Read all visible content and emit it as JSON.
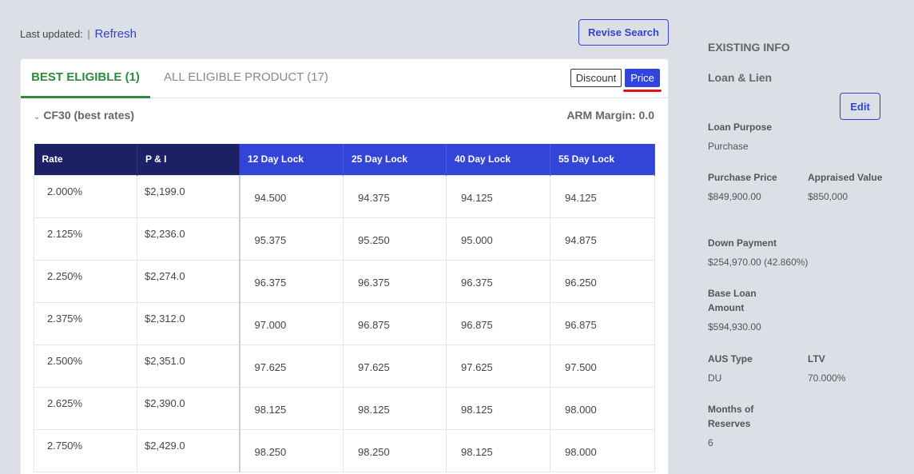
{
  "topbar": {
    "last_updated_label": "Last updated:",
    "separator": "|",
    "refresh_label": "Refresh"
  },
  "revise_search_label": "Revise Search",
  "tabs": [
    {
      "label": "BEST ELIGIBLE (1)"
    },
    {
      "label": "ALL ELIGIBLE PRODUCT (17)"
    }
  ],
  "toggle": {
    "discount_label": "Discount",
    "price_label": "Price"
  },
  "group": {
    "label": "CF30 (best rates)",
    "arm_margin": "ARM Margin: 0.0"
  },
  "table": {
    "headers": [
      "Rate",
      "P & I",
      "12 Day Lock",
      "25 Day Lock",
      "40 Day Lock",
      "55 Day Lock"
    ],
    "rows": [
      [
        "2.000%",
        "$2,199.0",
        "94.500",
        "94.375",
        "94.125",
        "94.125"
      ],
      [
        "2.125%",
        "$2,236.0",
        "95.375",
        "95.250",
        "95.000",
        "94.875"
      ],
      [
        "2.250%",
        "$2,274.0",
        "96.375",
        "96.375",
        "96.375",
        "96.250"
      ],
      [
        "2.375%",
        "$2,312.0",
        "97.000",
        "96.875",
        "96.875",
        "96.875"
      ],
      [
        "2.500%",
        "$2,351.0",
        "97.625",
        "97.625",
        "97.625",
        "97.500"
      ],
      [
        "2.625%",
        "$2,390.0",
        "98.125",
        "98.125",
        "98.125",
        "98.000"
      ],
      [
        "2.750%",
        "$2,429.0",
        "98.250",
        "98.250",
        "98.125",
        "98.000"
      ]
    ]
  },
  "existing": {
    "heading": "EXISTING INFO",
    "subheading": "Loan & Lien",
    "edit_label": "Edit",
    "loan_purpose": {
      "label": "Loan Purpose",
      "value": "Purchase"
    },
    "purchase_price": {
      "label": "Purchase Price",
      "value": "$849,900.00"
    },
    "appraised_value": {
      "label": "Appraised Value",
      "value": "$850,000"
    },
    "down_payment": {
      "label": "Down Payment",
      "value": "$254,970.00 (42.860%)"
    },
    "base_loan_amount": {
      "label": "Base Loan Amount",
      "value": "$594,930.00"
    },
    "aus_type": {
      "label": "AUS Type",
      "value": "DU"
    },
    "ltv": {
      "label": "LTV",
      "value": "70.000%"
    },
    "months_reserves": {
      "label": "Months of Reserves",
      "value": "6"
    }
  },
  "colors": {
    "accent_blue": "#3344dd",
    "header_dark": "#1c2166",
    "active_tab_green": "#2e8b3a",
    "price_underline_red": "#e0141e"
  }
}
